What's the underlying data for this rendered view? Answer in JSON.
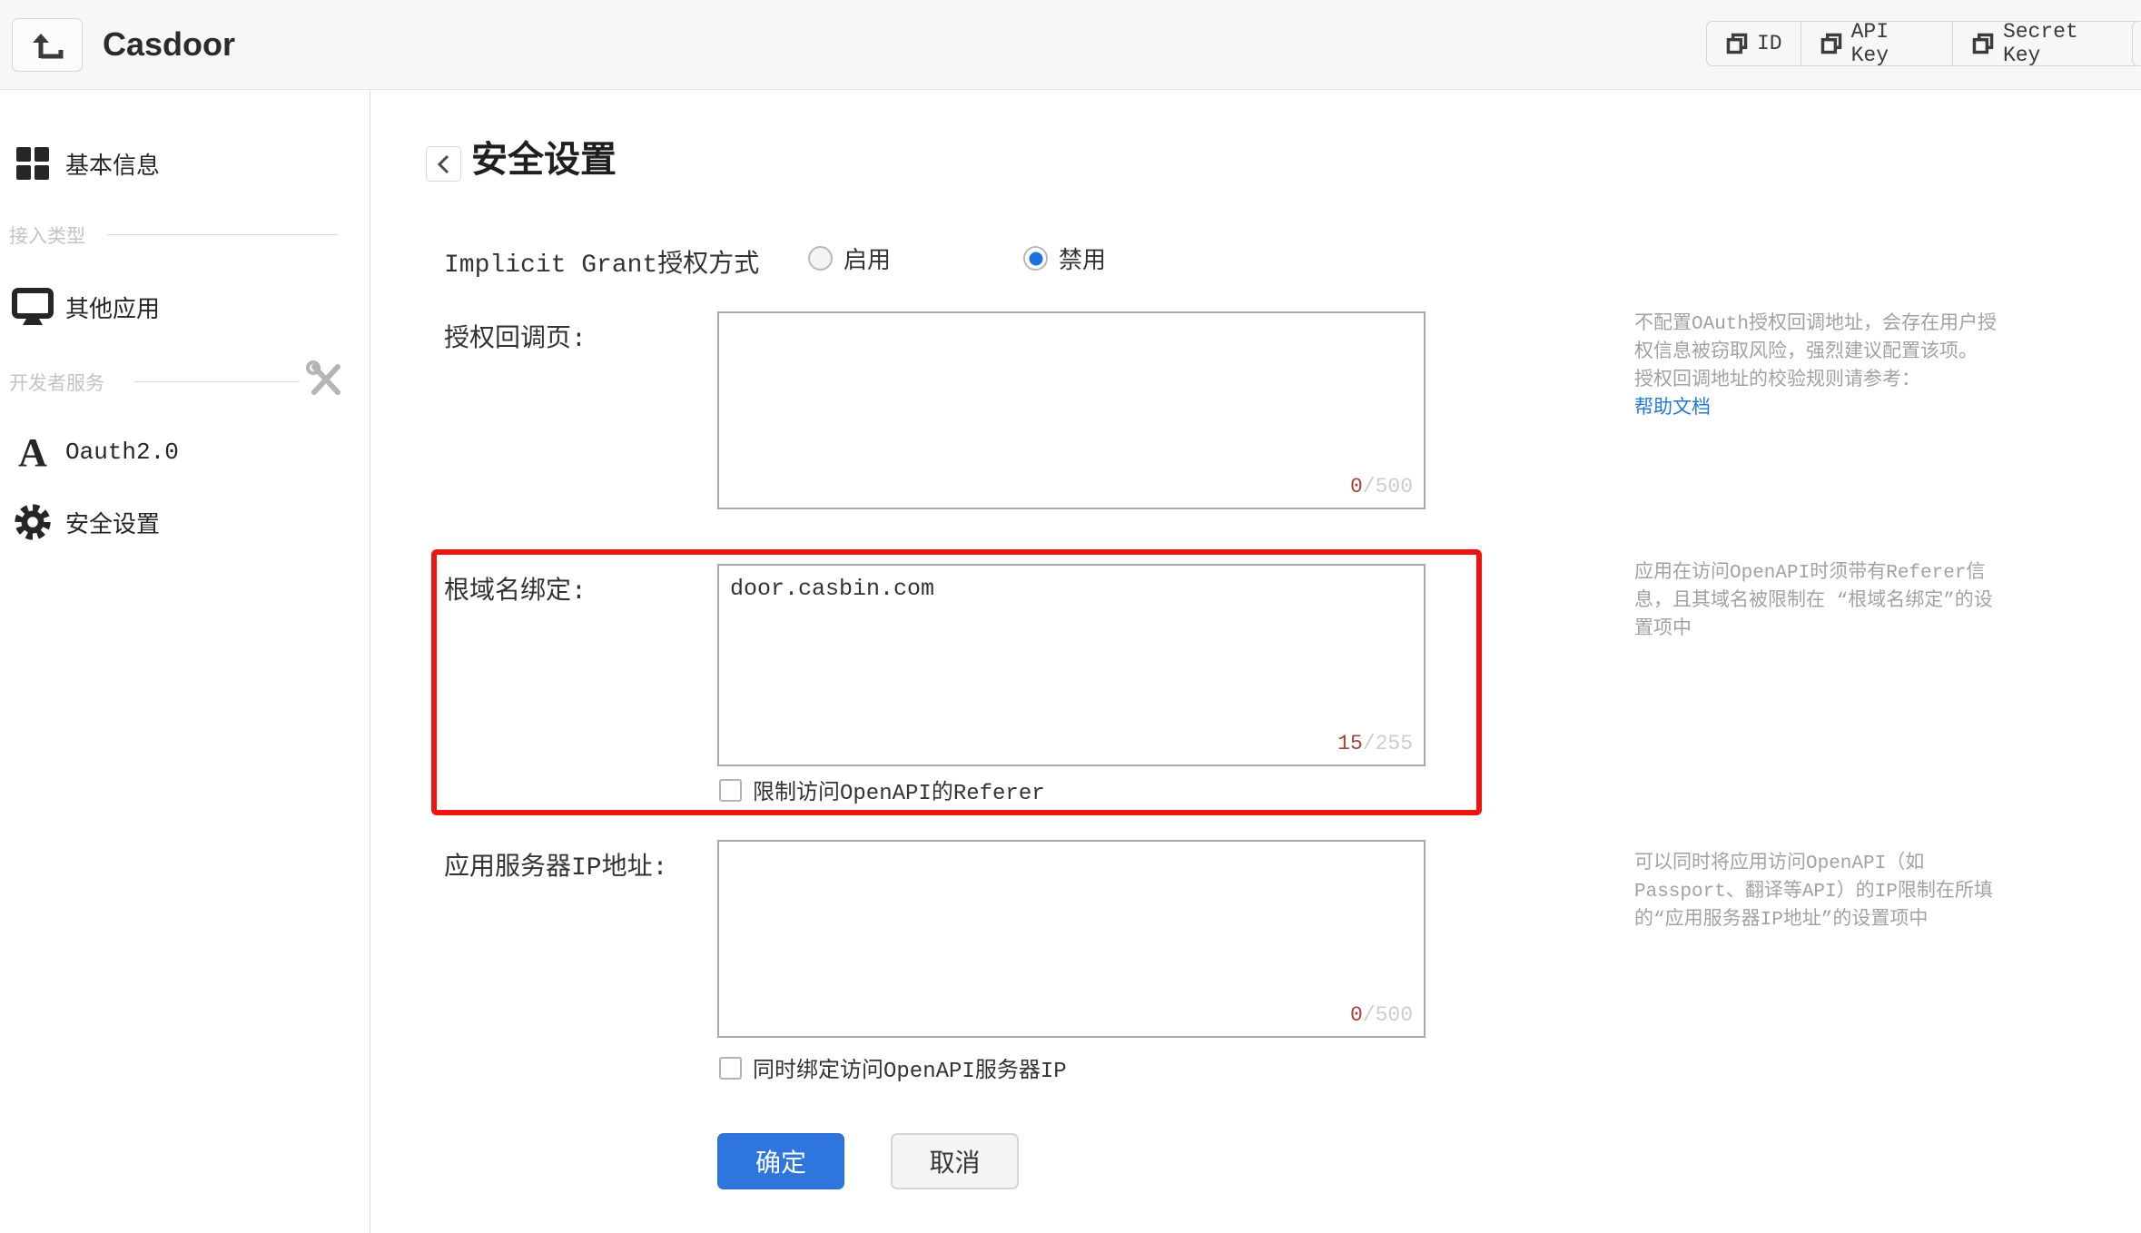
{
  "header": {
    "app_title": "Casdoor",
    "copy_buttons": [
      {
        "label": "ID"
      },
      {
        "label": "API Key"
      },
      {
        "label": "Secret Key"
      }
    ]
  },
  "sidebar": {
    "items": [
      {
        "label": "基本信息",
        "icon": "grid-icon"
      },
      {
        "label": "其他应用",
        "icon": "monitor-icon"
      },
      {
        "label": "Oauth2.0",
        "icon": "font-a-icon"
      },
      {
        "label": "安全设置",
        "icon": "gear-icon"
      }
    ],
    "dividers": [
      {
        "label": "接入类型"
      },
      {
        "label": "开发者服务",
        "icon": "tools-icon"
      }
    ]
  },
  "main": {
    "page_title": "安全设置",
    "implicit": {
      "label": "Implicit Grant授权方式",
      "options": [
        {
          "label": "启用",
          "selected": false
        },
        {
          "label": "禁用",
          "selected": true
        }
      ]
    },
    "rows": [
      {
        "label": "授权回调页:",
        "value": "",
        "counter_value": "0",
        "counter_max": "/500",
        "help": [
          "不配置OAuth授权回调地址，会存在用户授权信息被窃取风险，强烈建议配置该项。",
          "授权回调地址的校验规则请参考："
        ],
        "help_link": "帮助文档"
      },
      {
        "label": "根域名绑定:",
        "value": "door.casbin.com",
        "counter_value": "15",
        "counter_max": "/255",
        "checkbox_label": "限制访问OpenAPI的Referer",
        "checkbox_checked": false,
        "highlighted": true,
        "help": [
          "应用在访问OpenAPI时须带有Referer信息，且其域名被限制在 “根域名绑定”的设置项中"
        ]
      },
      {
        "label": "应用服务器IP地址:",
        "value": "",
        "counter_value": "0",
        "counter_max": "/500",
        "checkbox_label": "同时绑定访问OpenAPI服务器IP",
        "checkbox_checked": false,
        "help": [
          "可以同时将应用访问OpenAPI（如Passport、翻译等API）的IP限制在所填的“应用服务器IP地址”的设置项中"
        ]
      }
    ],
    "buttons": {
      "ok": "确定",
      "cancel": "取消"
    }
  },
  "colors": {
    "primary_button": "#2e75de",
    "highlight_border": "#ee1511",
    "link": "#2577d4",
    "counter_value": "#a5423a",
    "radio_selected": "#1e6fe0"
  }
}
